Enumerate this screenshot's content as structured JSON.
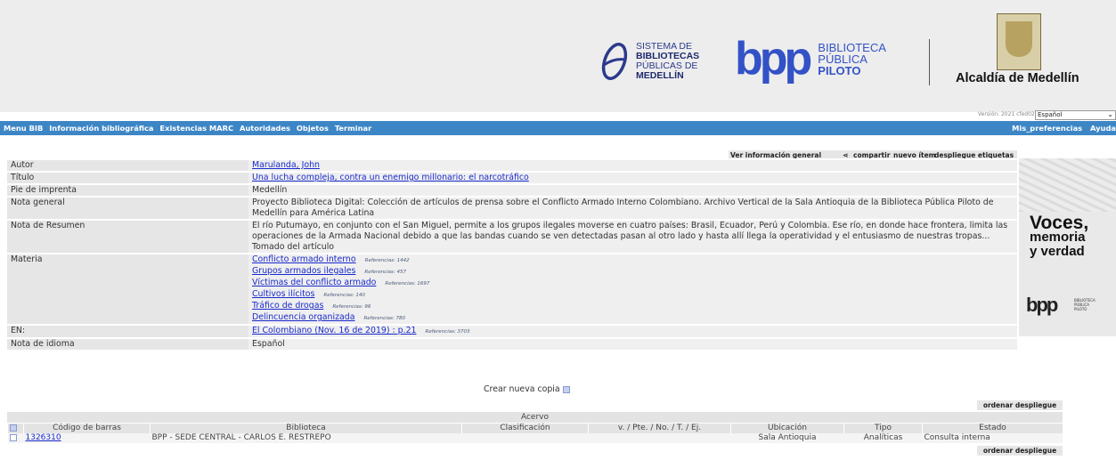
{
  "header": {
    "sbp": {
      "line1": "SISTEMA DE",
      "line2": "BIBLIOTECAS",
      "line3": "PÚBLICAS DE",
      "line4": "MEDELLÍN"
    },
    "bpp": {
      "word": "bpp",
      "line1": "BIBLIOTECA",
      "line2": "PÚBLICA",
      "line3": "PILOTO"
    },
    "alcaldia": "Alcaldía de Medellín",
    "version": "Versión: 2021 cfed02a36",
    "language": "Español"
  },
  "nav": {
    "items": [
      "Menu BIB",
      "Información bibliográfica",
      "Existencias MARC",
      "Autoridades",
      "Objetos",
      "Terminar"
    ],
    "right": [
      "Mis_preferencias",
      "Ayuda"
    ]
  },
  "actions": [
    "Ver información general",
    "compartir",
    "nuevo ítem",
    "despliegue etiquetas"
  ],
  "record": {
    "autor": {
      "label": "Autor",
      "value": "Marulanda, John"
    },
    "titulo": {
      "label": "Título",
      "value": "Una lucha compleja, contra un enemigo millonario: el narcotráfico"
    },
    "pie": {
      "label": "Pie de imprenta",
      "value": "Medellín"
    },
    "nota_general": {
      "label": "Nota general",
      "value": "Proyecto Biblioteca Digital: Colección de artículos de prensa sobre el Conflicto Armado Interno Colombiano. Archivo Vertical de la Sala Antioquia de la Biblioteca Pública Piloto de Medellín para América Latina"
    },
    "resumen": {
      "label": "Nota de Resumen",
      "value": "El río Putumayo, en conjunto con el San Miguel, permite a los grupos ilegales moverse en cuatro países: Brasil, Ecuador, Perú y Colombia. Ese río, en donde hace frontera, limita las operaciones de la Armada Nacional debido a que las bandas cuando se ven detectadas pasan al otro lado y hasta allí llega la operatividad y el entusiasmo de nuestras tropas... Tomado del artículo"
    },
    "materia": {
      "label": "Materia",
      "items": [
        {
          "term": "Conflicto armado interno",
          "refs": "Referencias: 1442"
        },
        {
          "term": "Grupos armados ilegales",
          "refs": "Referencias: 457"
        },
        {
          "term": "Víctimas del conflicto armado",
          "refs": "Referencias: 1697"
        },
        {
          "term": "Cultivos ilícitos",
          "refs": "Referencias: 140"
        },
        {
          "term": "Tráfico de drogas",
          "refs": "Referencias: 96"
        },
        {
          "term": "Delincuencia organizada",
          "refs": "Referencias: 780"
        }
      ]
    },
    "en": {
      "label": "EN:",
      "value": "El Colombiano (Nov. 16 de 2019) : p.21",
      "refs": "Referencias: 3703"
    },
    "idioma": {
      "label": "Nota de idioma",
      "value": "Español"
    }
  },
  "side_ad": {
    "line1": "Voces,",
    "line2": "memoria",
    "line3": "y verdad",
    "logo": "bpp",
    "sub1": "BIBLIOTECA",
    "sub2": "PÚBLICA",
    "sub3": "PILOTO"
  },
  "copies": {
    "crear": "Crear nueva copia",
    "ordenar": "ordenar despliegue",
    "acervo": "Acervo",
    "headers": [
      "Código de barras",
      "Biblioteca",
      "Clasificación",
      "v. / Pte. / No. / T. / Ej.",
      "Ubicación",
      "Tipo",
      "Estado"
    ],
    "rows": [
      {
        "barcode": "1326310",
        "biblioteca": "BPP - SEDE CENTRAL - CARLOS E. RESTREPO",
        "clasificacion": "",
        "vol": "",
        "ubicacion": "Sala Antioquia",
        "tipo": "Analíticas",
        "estado": "Consulta interna"
      }
    ]
  }
}
